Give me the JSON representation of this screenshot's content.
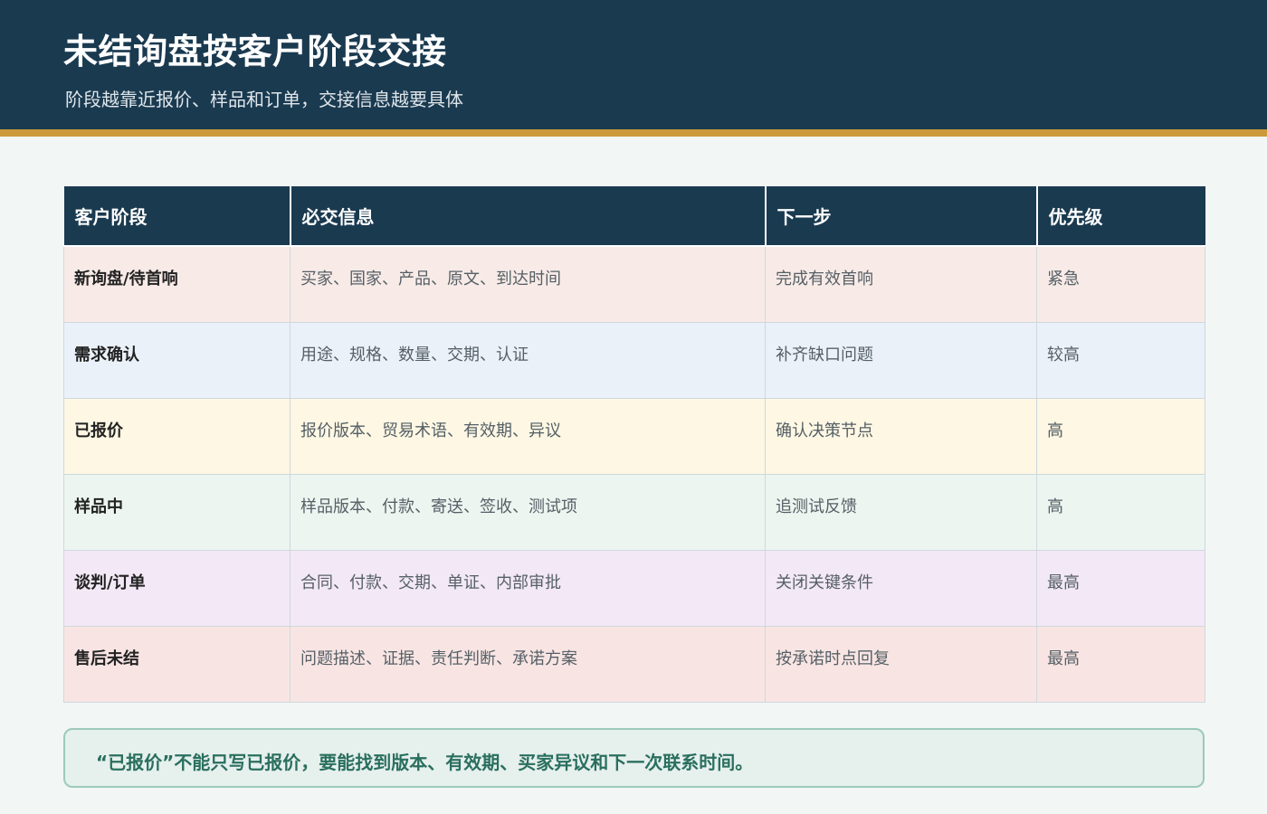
{
  "header": {
    "title": "未结询盘按客户阶段交接",
    "subtitle": "阶段越靠近报价、样品和订单，交接信息越要具体"
  },
  "table": {
    "columns": [
      "客户阶段",
      "必交信息",
      "下一步",
      "优先级"
    ],
    "rows": [
      {
        "stage": "新询盘/待首响",
        "info": "买家、国家、产品、原文、到达时间",
        "next": "完成有效首响",
        "priority": "紧急",
        "bg": "#f8ebe7"
      },
      {
        "stage": "需求确认",
        "info": "用途、规格、数量、交期、认证",
        "next": "补齐缺口问题",
        "priority": "较高",
        "bg": "#eaf1f9"
      },
      {
        "stage": "已报价",
        "info": "报价版本、贸易术语、有效期、异议",
        "next": "确认决策节点",
        "priority": "高",
        "bg": "#fdf7e3"
      },
      {
        "stage": "样品中",
        "info": "样品版本、付款、寄送、签收、测试项",
        "next": "追测试反馈",
        "priority": "高",
        "bg": "#ecf5ef"
      },
      {
        "stage": "谈判/订单",
        "info": "合同、付款、交期、单证、内部审批",
        "next": "关闭关键条件",
        "priority": "最高",
        "bg": "#f3e8f6"
      },
      {
        "stage": "售后未结",
        "info": "问题描述、证据、责任判断、承诺方案",
        "next": "按承诺时点回复",
        "priority": "最高",
        "bg": "#f8e5e3"
      }
    ]
  },
  "note": {
    "text": "“已报价”不能只写已报价，要能找到版本、有效期、买家异议和下一次联系时间。"
  },
  "colors": {
    "header_bg": "#1a3a50",
    "accent_bar": "#cc9a3a",
    "note_text": "#2a6f5e"
  }
}
